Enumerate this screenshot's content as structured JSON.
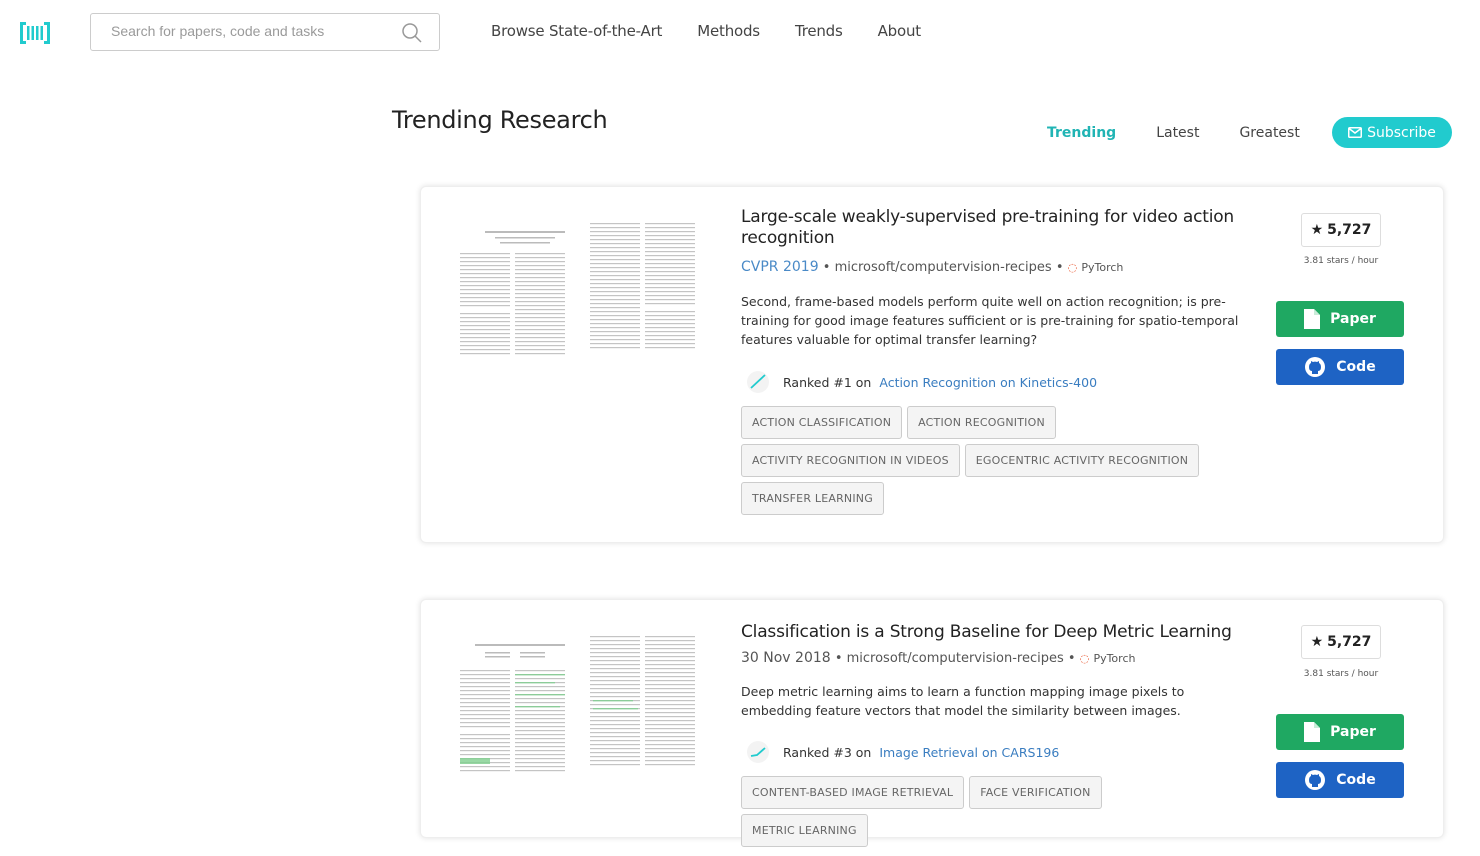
{
  "nav": {
    "search_placeholder": "Search for papers, code and tasks",
    "links": [
      "Browse State-of-the-Art",
      "Methods",
      "Trends",
      "About"
    ]
  },
  "header": {
    "title": "Trending Research",
    "tabs": [
      "Trending",
      "Latest",
      "Greatest"
    ],
    "active_tab": "Trending",
    "subscribe_label": "Subscribe"
  },
  "colors": {
    "accent": "#21cbce",
    "paper_button": "#1fa862",
    "code_button": "#1e63c4",
    "link": "#3a7dc0"
  },
  "papers": [
    {
      "title": "Large-scale weakly-supervised pre-training for video action recognition",
      "venue": "CVPR 2019",
      "repo": "microsoft/computervision-recipes",
      "framework": "PyTorch",
      "abstract": "Second, frame-based models perform quite well on action recognition; is pre-training for good image features sufficient or is pre-training for spatio-temporal features valuable for optimal transfer learning?",
      "rank_prefix": "Ranked #1 on",
      "rank_task": "Action Recognition on Kinetics-400",
      "tags": [
        "Action Classification",
        "Action Recognition",
        "Activity Recognition In Videos",
        "Egocentric Activity Recognition",
        "Transfer Learning"
      ],
      "stars": "5,727",
      "stars_rate": "3.81 stars / hour",
      "paper_label": "Paper",
      "code_label": "Code"
    },
    {
      "title": "Classification is a Strong Baseline for Deep Metric Learning",
      "date": "30 Nov 2018",
      "repo": "microsoft/computervision-recipes",
      "framework": "PyTorch",
      "abstract": "Deep metric learning aims to learn a function mapping image pixels to embedding feature vectors that model the similarity between images.",
      "rank_prefix": "Ranked #3 on",
      "rank_task": "Image Retrieval on CARS196",
      "tags": [
        "Content-Based Image Retrieval",
        "Face Verification",
        "Metric Learning"
      ],
      "stars": "5,727",
      "stars_rate": "3.81 stars / hour",
      "paper_label": "Paper",
      "code_label": "Code"
    }
  ]
}
